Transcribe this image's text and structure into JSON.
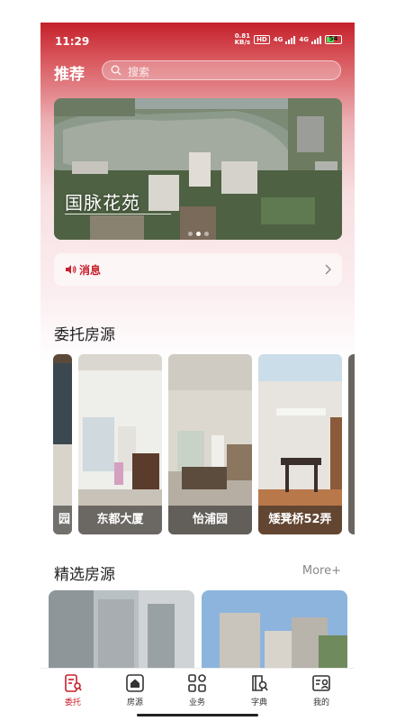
{
  "status_bar": {
    "time": "11:29",
    "speed_value": "0.81",
    "speed_unit": "KB/s",
    "hd": "HD",
    "network_1": "4G",
    "network_2": "4G",
    "battery": "54"
  },
  "header": {
    "title": "推荐",
    "search_placeholder": "搜索"
  },
  "banner": {
    "title": "国脉花苑",
    "dot_count": 3,
    "active_dot": 1
  },
  "notice": {
    "label": "消息"
  },
  "entrusted": {
    "title": "委托房源",
    "cards": [
      {
        "label": "园"
      },
      {
        "label": "东都大厦"
      },
      {
        "label": "怡浦园"
      },
      {
        "label": "矮凳桥52弄"
      },
      {
        "label": ""
      }
    ]
  },
  "featured": {
    "title": "精选房源",
    "more": "More+"
  },
  "tabbar": {
    "tabs": [
      {
        "label": "委托",
        "icon": "entrust-icon",
        "active": true
      },
      {
        "label": "房源",
        "icon": "house-icon",
        "active": false
      },
      {
        "label": "业务",
        "icon": "grid-icon",
        "active": false
      },
      {
        "label": "字典",
        "icon": "dictionary-icon",
        "active": false
      },
      {
        "label": "我的",
        "icon": "profile-icon",
        "active": false
      }
    ]
  },
  "colors": {
    "brand_red": "#c7202b",
    "header_red": "#c5202a"
  }
}
